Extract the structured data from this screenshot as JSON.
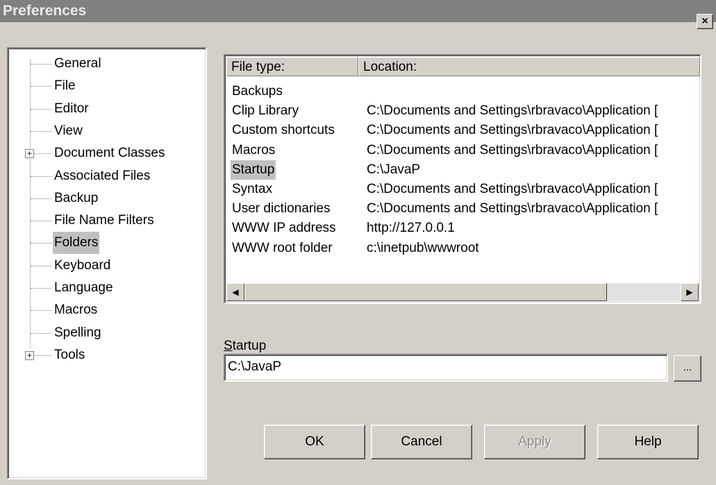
{
  "window": {
    "title": "Preferences",
    "close_label": "×"
  },
  "tree": {
    "items": [
      {
        "label": "General",
        "expandable": false
      },
      {
        "label": "File",
        "expandable": false
      },
      {
        "label": "Editor",
        "expandable": false
      },
      {
        "label": "View",
        "expandable": false
      },
      {
        "label": "Document Classes",
        "expandable": true
      },
      {
        "label": "Associated Files",
        "expandable": false
      },
      {
        "label": "Backup",
        "expandable": false
      },
      {
        "label": "File Name Filters",
        "expandable": false
      },
      {
        "label": "Folders",
        "expandable": false,
        "selected": true
      },
      {
        "label": "Keyboard",
        "expandable": false
      },
      {
        "label": "Language",
        "expandable": false
      },
      {
        "label": "Macros",
        "expandable": false
      },
      {
        "label": "Spelling",
        "expandable": false
      },
      {
        "label": "Tools",
        "expandable": true
      }
    ]
  },
  "list": {
    "headers": [
      "File type:",
      "Location:"
    ],
    "rows": [
      {
        "type": "Backups",
        "location": ""
      },
      {
        "type": "Clip Library",
        "location": "C:\\Documents and Settings\\rbravaco\\Application [",
        "selected": false
      },
      {
        "type": "Custom shortcuts",
        "location": "C:\\Documents and Settings\\rbravaco\\Application ["
      },
      {
        "type": "Macros",
        "location": "C:\\Documents and Settings\\rbravaco\\Application ["
      },
      {
        "type": "Startup",
        "location": "C:\\JavaP",
        "selected": true
      },
      {
        "type": "Syntax",
        "location": "C:\\Documents and Settings\\rbravaco\\Application ["
      },
      {
        "type": "User dictionaries",
        "location": "C:\\Documents and Settings\\rbravaco\\Application ["
      },
      {
        "type": "WWW IP address",
        "location": "http://127.0.0.1"
      },
      {
        "type": "WWW root folder",
        "location": "c:\\inetpub\\wwwroot"
      }
    ]
  },
  "field": {
    "label_underlined": "S",
    "label_rest": "tartup",
    "value": "C:\\JavaP",
    "browse_label": "..."
  },
  "buttons": {
    "ok": "OK",
    "cancel": "Cancel",
    "apply": "Apply",
    "help": "Help"
  }
}
